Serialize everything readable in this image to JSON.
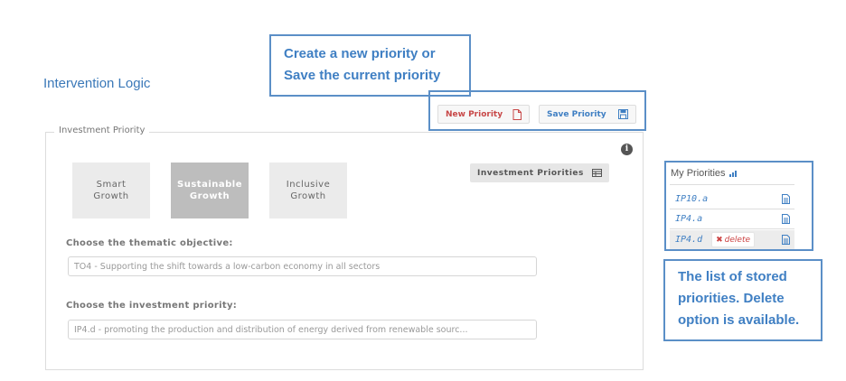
{
  "page": {
    "title": "Intervention Logic"
  },
  "callouts": {
    "top": [
      "Create a new priority or",
      "Save the current priority"
    ],
    "bottom": [
      "The list of stored",
      "priorities. Delete",
      "option is available."
    ]
  },
  "toolbar": {
    "new_label": "New Priority",
    "save_label": "Save Priority",
    "new_icon": "new-file-icon",
    "save_icon": "floppy-disk-icon",
    "colors": {
      "new": "#c84848",
      "save": "#3f7fc3"
    }
  },
  "investment": {
    "legend": "Investment Priority",
    "info_icon": "i",
    "growth": [
      {
        "line1": "Smart",
        "line2": "Growth",
        "selected": false
      },
      {
        "line1": "Sustainable",
        "line2": "Growth",
        "selected": true
      },
      {
        "line1": "Inclusive",
        "line2": "Growth",
        "selected": false
      }
    ],
    "priorities_button": "Investment Priorities",
    "priorities_icon": "table-icon",
    "thematic_label": "Choose the thematic objective:",
    "thematic_value": "TO4 - Supporting the shift towards a low-carbon economy in all sectors",
    "priority_label": "Choose the investment priority:",
    "priority_value": "IP4.d - promoting the production and distribution of energy derived from renewable sourc..."
  },
  "my_priorities": {
    "title": "My Priorities",
    "title_icon": "bar-chart-icon",
    "items": [
      {
        "code": "IP10.a",
        "selected": false
      },
      {
        "code": "IP4.a",
        "selected": false
      },
      {
        "code": "IP4.d",
        "selected": true
      }
    ],
    "delete_label": "delete",
    "delete_icon": "✖"
  }
}
